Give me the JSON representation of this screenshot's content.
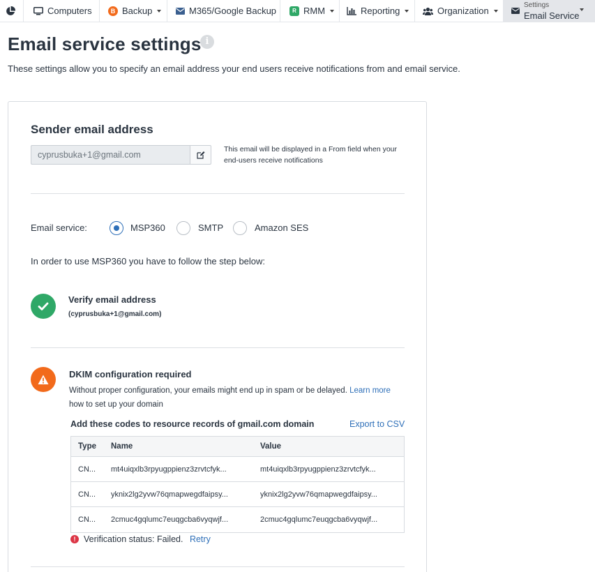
{
  "nav": {
    "computers": "Computers",
    "backup": "Backup",
    "m365": "M365/Google Backup",
    "rmm": "RMM",
    "reporting": "Reporting",
    "organization": "Organization",
    "settings_small": "Settings",
    "settings_large": "Email Service"
  },
  "header": {
    "title": "Email service settings",
    "info": "i",
    "description": "These settings allow you to specify an email address your end users receive notifications from and email service."
  },
  "sender": {
    "title": "Sender email address",
    "email": "cyprusbuka+1@gmail.com",
    "hint": "This email will be displayed in a From field when your end-users receive notifications"
  },
  "service": {
    "label": "Email service:",
    "options": [
      "MSP360",
      "SMTP",
      "Amazon SES"
    ],
    "selected": "MSP360",
    "instruction": "In order to use MSP360 you have to follow the step below:"
  },
  "verify": {
    "title": "Verify email address",
    "email": "(cyprusbuka+1@gmail.com)"
  },
  "dkim": {
    "title": "DKIM configuration required",
    "desc_prefix": "Without proper configuration, your emails might end up in spam or be delayed.",
    "learn_more": "Learn more",
    "desc_suffix": "how to set up your domain",
    "codes_title": "Add these codes to resource records of gmail.com domain",
    "export": "Export to CSV",
    "columns": [
      "Type",
      "Name",
      "Value"
    ],
    "rows": [
      {
        "type": "CN...",
        "name": "mt4uiqxlb3rpyugppienz3zrvtcfyk...",
        "value": "mt4uiqxlb3rpyugppienz3zrvtcfyk..."
      },
      {
        "type": "CN...",
        "name": "yknix2lg2yvw76qmapwegdfaipsy...",
        "value": "yknix2lg2yvw76qmapwegdfaipsy..."
      },
      {
        "type": "CN...",
        "name": "2cmuc4gqlumc7euqgcba6vyqwjf...",
        "value": "2cmuc4gqlumc7euqgcba6vyqwjf..."
      }
    ],
    "status_label": "Verification status:",
    "status_value": "Failed.",
    "retry": "Retry"
  },
  "colors": {
    "accent": "#2e6fb8",
    "success": "#2fa867",
    "warning": "#f26a1b",
    "error": "#dc3545"
  }
}
